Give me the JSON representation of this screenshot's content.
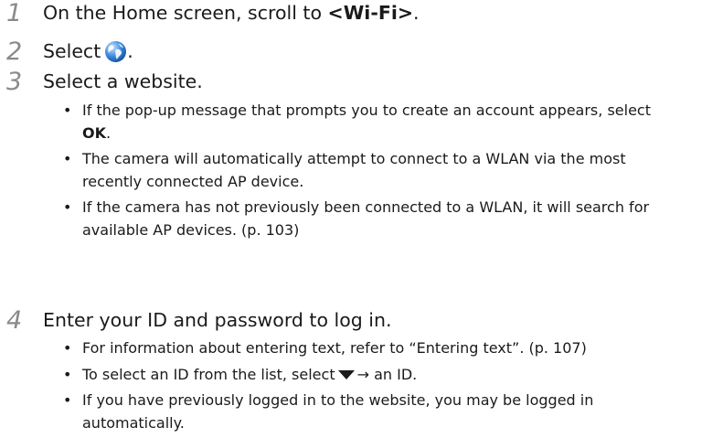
{
  "steps": [
    {
      "num": "1",
      "before": "On the Home screen, scroll to ",
      "bold": "<Wi-Fi>",
      "after": "."
    },
    {
      "num": "2",
      "before": "Select",
      "icon": "globe-icon",
      "after": "."
    },
    {
      "num": "3",
      "text": "Select a website.",
      "bullets": [
        {
          "l1": "If the pop-up message that prompts you to create an account appears, select",
          "bold": "OK",
          "after": "."
        },
        {
          "l1": "The camera will automatically attempt to connect to a WLAN via the most",
          "l2": "recently connected AP device."
        },
        {
          "l1": "If the camera has not previously been connected to a WLAN, it will search for",
          "l2": "available AP devices. (p. 103)"
        }
      ]
    },
    {
      "num": "4",
      "text": "Enter your ID and password to log in.",
      "bullets": [
        {
          "l1": "For information about entering text, refer to “Entering text”. (p. 107)"
        },
        {
          "before": "To select an ID from the list, select",
          "icon": "down-triangle-icon",
          "after": "→ an ID."
        },
        {
          "l1": "If you have previously logged in to the website, you may be logged in",
          "l2": "automatically."
        }
      ]
    }
  ]
}
